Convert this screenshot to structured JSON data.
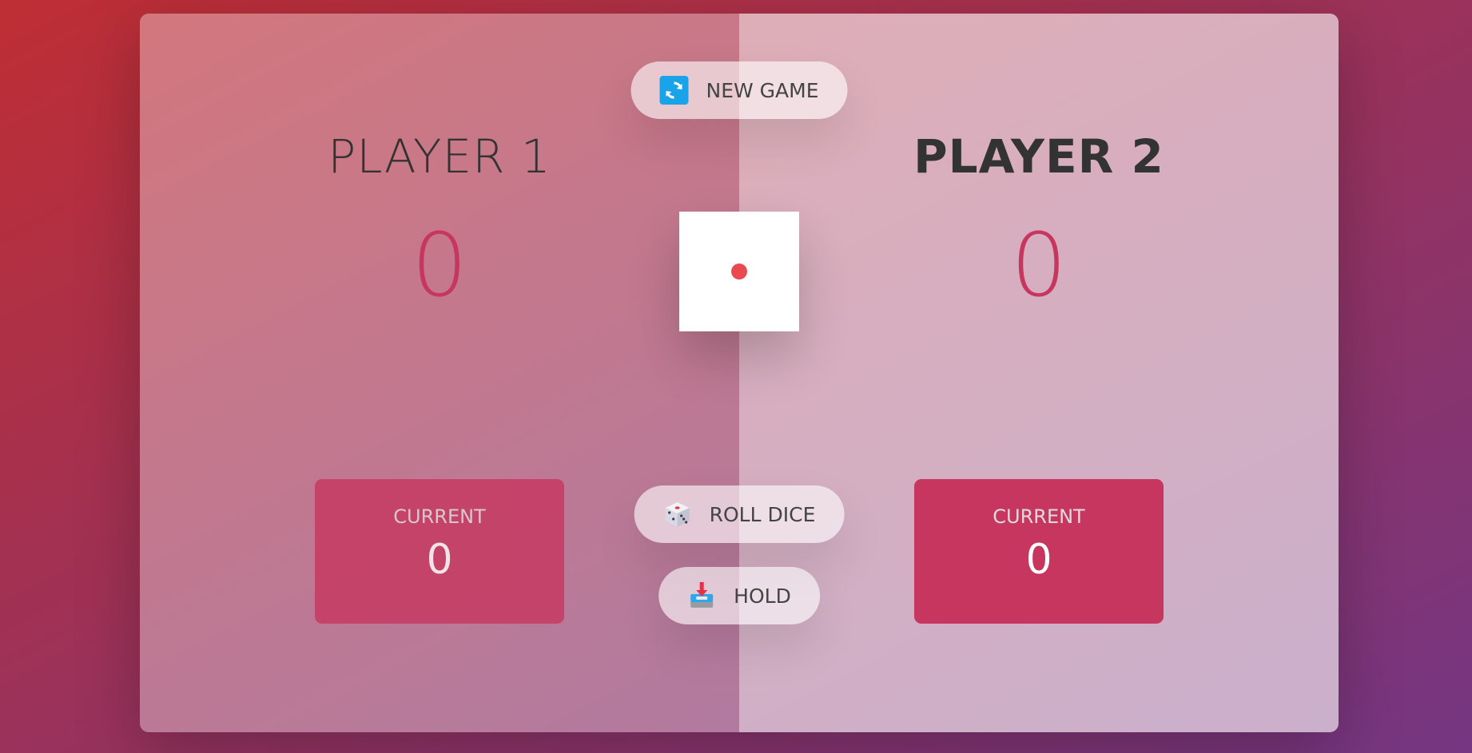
{
  "players": [
    {
      "name": "PLAYER 1",
      "score": "0",
      "current_label": "CURRENT",
      "current_score": "0",
      "active": false
    },
    {
      "name": "PLAYER 2",
      "score": "0",
      "current_label": "CURRENT",
      "current_score": "0",
      "active": true
    }
  ],
  "buttons": {
    "new_game": {
      "label": "NEW GAME",
      "icon": "refresh-icon"
    },
    "roll_dice": {
      "label": "ROLL DICE",
      "icon": "dice-icon"
    },
    "hold": {
      "label": "HOLD",
      "icon": "inbox-download-icon"
    }
  },
  "dice": {
    "value": 1,
    "pip_color": "#e84a4f"
  },
  "colors": {
    "accent": "#c7365f",
    "background_start": "#bf2e34",
    "background_end": "#753682"
  }
}
